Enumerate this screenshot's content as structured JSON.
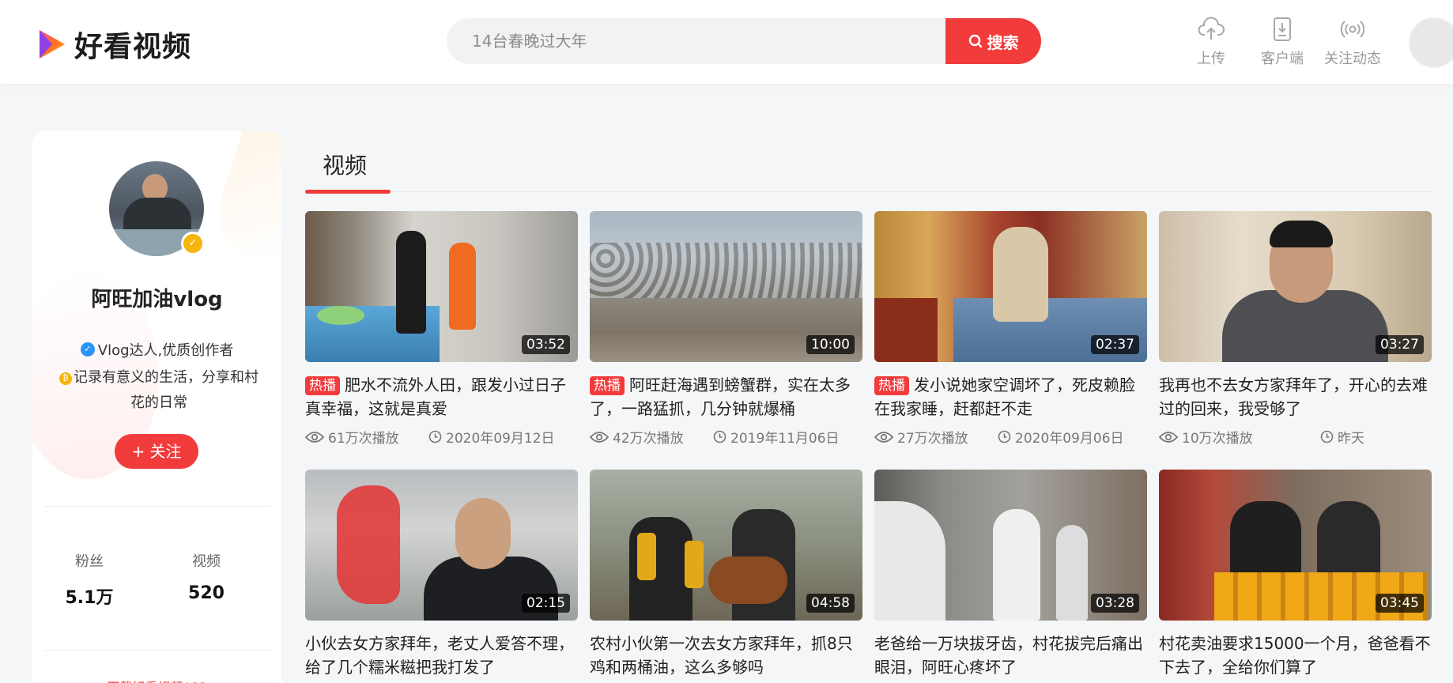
{
  "header": {
    "logo_text": "好看视频",
    "search_placeholder": "14台春晚过大年",
    "search_button": "搜索",
    "nav": [
      {
        "label": "上传",
        "icon": "cloud-upload-icon"
      },
      {
        "label": "客户端",
        "icon": "download-client-icon"
      },
      {
        "label": "关注动态",
        "icon": "broadcast-icon"
      }
    ]
  },
  "profile": {
    "name": "阿旺加油vlog",
    "tag": "Vlog达人,优质创作者",
    "desc": "记录有意义的生活，分享和村花的日常",
    "follow_label": "+ 关注",
    "stats": [
      {
        "label": "粉丝",
        "value": "5.1万"
      },
      {
        "label": "视频",
        "value": "520"
      }
    ],
    "download": "下载好看视频APP"
  },
  "tab_label": "视频",
  "hot_label": "热播",
  "videos": [
    {
      "title": "肥水不流外人田，跟发小过日子真幸福，这就是真爱",
      "hot": true,
      "duration": "03:52",
      "plays": "61万次播放",
      "date": "2020年09月12日"
    },
    {
      "title": "阿旺赶海遇到螃蟹群，实在太多了，一路猛抓，几分钟就爆桶",
      "hot": true,
      "duration": "10:00",
      "plays": "42万次播放",
      "date": "2019年11月06日"
    },
    {
      "title": "发小说她家空调坏了，死皮赖脸在我家睡，赶都赶不走",
      "hot": true,
      "duration": "02:37",
      "plays": "27万次播放",
      "date": "2020年09月06日"
    },
    {
      "title": "我再也不去女方家拜年了，开心的去难过的回来，我受够了",
      "hot": false,
      "duration": "03:27",
      "plays": "10万次播放",
      "date": "昨天"
    },
    {
      "title": "小伙去女方家拜年，老丈人爱答不理，给了几个糯米糍把我打发了",
      "hot": false,
      "duration": "02:15",
      "plays": "",
      "date": ""
    },
    {
      "title": "农村小伙第一次去女方家拜年，抓8只鸡和两桶油，这么多够吗",
      "hot": false,
      "duration": "04:58",
      "plays": "",
      "date": ""
    },
    {
      "title": "老爸给一万块拔牙齿，村花拔完后痛出眼泪，阿旺心疼坏了",
      "hot": false,
      "duration": "03:28",
      "plays": "",
      "date": ""
    },
    {
      "title": "村花卖油要求15000一个月，爸爸看不下去了，全给你们算了",
      "hot": false,
      "duration": "03:45",
      "plays": "",
      "date": ""
    }
  ]
}
